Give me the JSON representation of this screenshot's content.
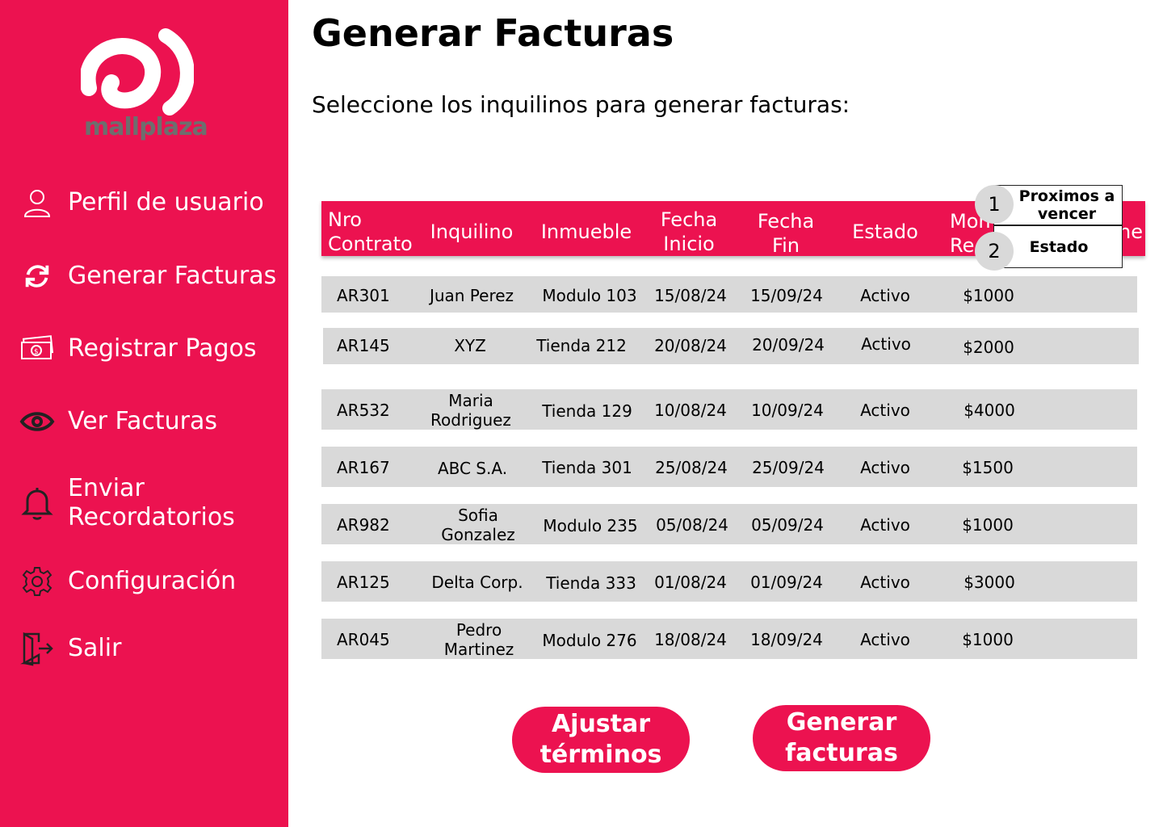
{
  "brand": {
    "name": "mallplaza",
    "accent": "#EC1250"
  },
  "sidebar": {
    "items": [
      {
        "label": "Perfil de usuario",
        "icon": "user-icon"
      },
      {
        "label": "Generar Facturas",
        "icon": "refresh-icon"
      },
      {
        "label": "Registrar Pagos",
        "icon": "money-icon"
      },
      {
        "label": "Ver Facturas",
        "icon": "eye-icon"
      },
      {
        "label": "Enviar Recordatorios",
        "icon": "bell-icon"
      },
      {
        "label": "Configuración",
        "icon": "gear-icon"
      },
      {
        "label": "Salir",
        "icon": "logout-icon"
      }
    ]
  },
  "main": {
    "title": "Generar Facturas",
    "subtitle": "Seleccione los inquilinos para generar facturas:"
  },
  "table": {
    "headers": [
      "Nro Contrato",
      "Inquilino",
      "Inmueble",
      "Fecha Inicio",
      "Fecha Fin",
      "Estado",
      "Mon Re",
      "ne"
    ],
    "rows": [
      [
        "AR301",
        "Juan Perez",
        "Modulo 103",
        "15/08/24",
        "15/09/24",
        "Activo",
        "$1000"
      ],
      [
        "AR145",
        "XYZ",
        "Tienda 212",
        "20/08/24",
        "20/09/24",
        "Activo",
        "$2000"
      ],
      [
        "AR532",
        "Maria Rodriguez",
        "Tienda 129",
        "10/08/24",
        "10/09/24",
        "Activo",
        "$4000"
      ],
      [
        "AR167",
        "ABC S.A.",
        "Tienda 301",
        "25/08/24",
        "25/09/24",
        "Activo",
        "$1500"
      ],
      [
        "AR982",
        "Sofia Gonzalez",
        "Modulo 235",
        "05/08/24",
        "05/09/24",
        "Activo",
        "$1000"
      ],
      [
        "AR125",
        "Delta Corp.",
        "Tienda 333",
        "01/08/24",
        "01/09/24",
        "Activo",
        "$3000"
      ],
      [
        "AR045",
        "Pedro Martinez",
        "Modulo 276",
        "18/08/24",
        "18/09/24",
        "Activo",
        "$1000"
      ]
    ]
  },
  "sort_menu": {
    "options": [
      {
        "number": "1",
        "label": "Proximos a vencer"
      },
      {
        "number": "2",
        "label": "Estado"
      }
    ]
  },
  "actions": {
    "adjust_label": "Ajustar términos",
    "generate_label": "Generar facturas"
  }
}
